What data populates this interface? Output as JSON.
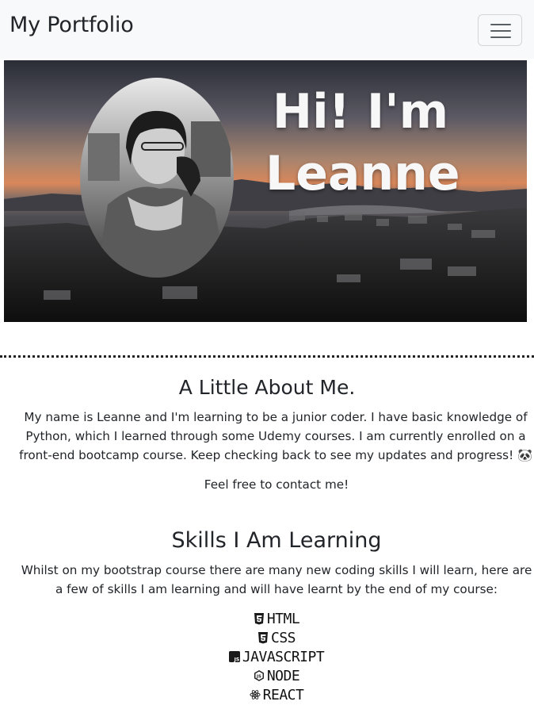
{
  "navbar": {
    "brand": "My Portfolio",
    "toggle_icon": "hamburger-icon"
  },
  "hero": {
    "title": "Hi! I'm Leanne"
  },
  "about": {
    "title": "A Little About Me.",
    "text": "My name is Leanne and I'm learning to be a junior coder. I have basic knowledge of Python, which I learned through some Udemy courses. I am currently enrolled on a front-end bootcamp course. Keep checking back to see my updates and progress! 🐼",
    "contact": "Feel free to contact me!"
  },
  "skills": {
    "title": "Skills I Am Learning",
    "text": "Whilst on my bootstrap course there are many new coding skills I will learn, here are a few of skills I am learning and will have learnt by the end of my course:",
    "items": [
      {
        "label": "HTML",
        "icon": "html5-icon"
      },
      {
        "label": "CSS",
        "icon": "css3-icon"
      },
      {
        "label": "JAVASCRIPT",
        "icon": "javascript-icon"
      },
      {
        "label": "NODE",
        "icon": "nodejs-icon"
      },
      {
        "label": "REACT",
        "icon": "react-icon"
      }
    ]
  }
}
